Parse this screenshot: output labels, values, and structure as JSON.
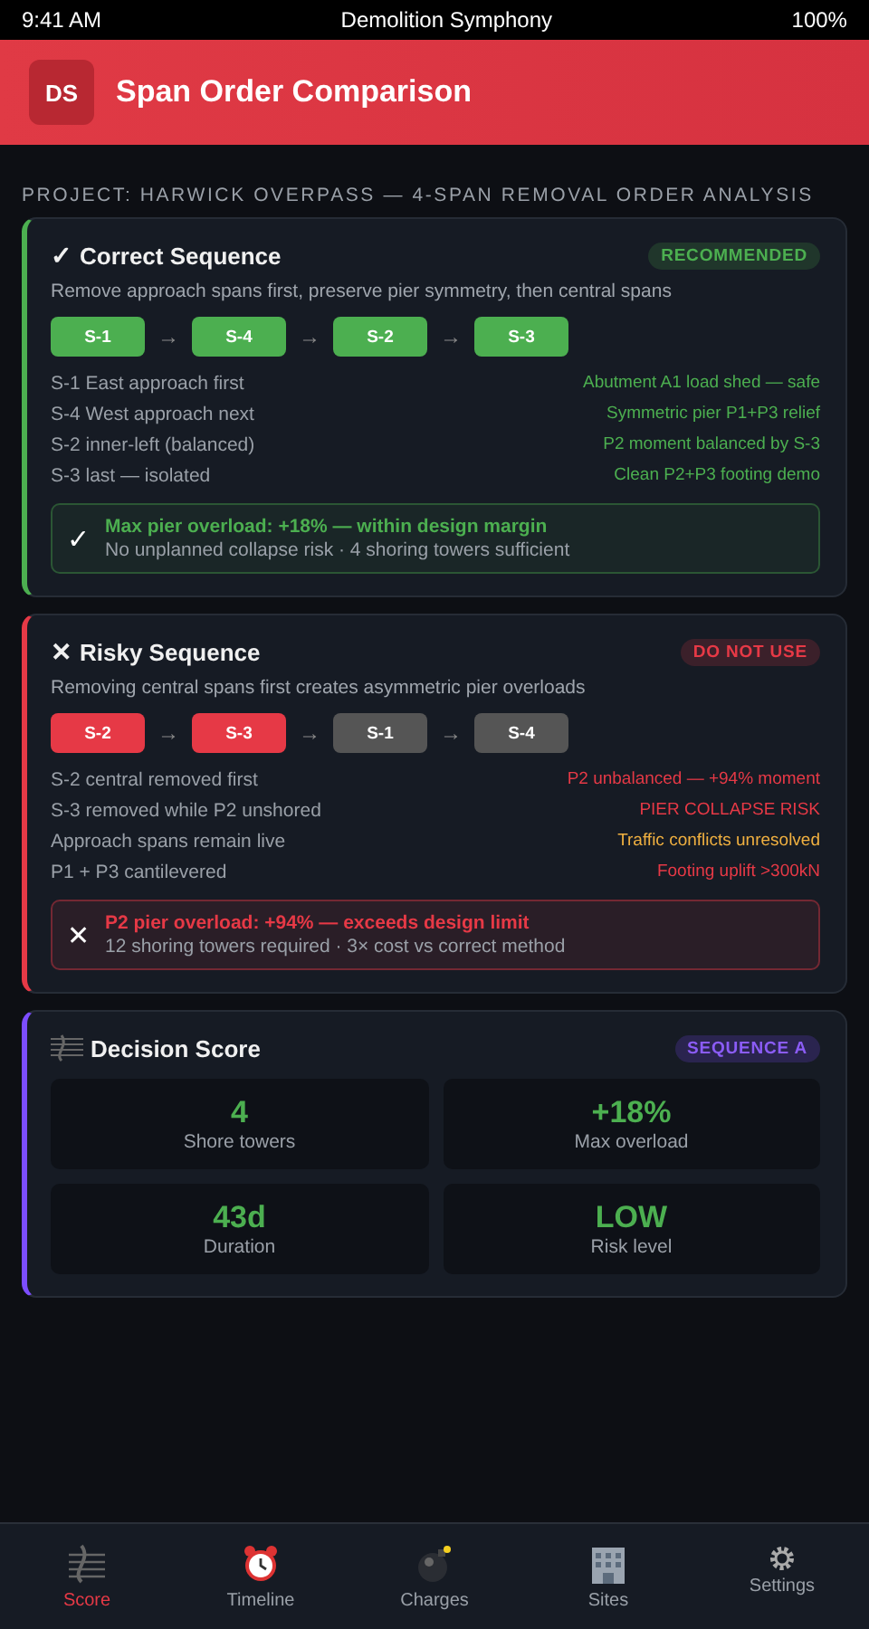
{
  "status_bar": {
    "time": "9:41 AM",
    "title": "Demolition Symphony",
    "battery": "100%"
  },
  "header": {
    "logo": "DS",
    "title": "Span Order Comparison"
  },
  "project_label": "PROJECT: HARWICK OVERPASS — 4-SPAN REMOVAL ORDER ANALYSIS",
  "sequences": [
    {
      "kind": "good",
      "mark": "✓",
      "title": "Correct Sequence",
      "badge": "RECOMMENDED",
      "description": "Remove approach spans first, preserve pier symmetry, then central spans",
      "steps": [
        {
          "label": "S-1",
          "color": "#4caf50"
        },
        {
          "label": "S-4",
          "color": "#4caf50"
        },
        {
          "label": "S-2",
          "color": "#4caf50"
        },
        {
          "label": "S-3",
          "color": "#4caf50"
        }
      ],
      "arrows": [
        "→",
        "→",
        "→"
      ],
      "rows": [
        {
          "label": "S-1 East approach first",
          "note": "Abutment A1 load shed — safe",
          "color": "#4caf50"
        },
        {
          "label": "S-4 West approach next",
          "note": "Symmetric pier P1+P3 relief",
          "color": "#4caf50"
        },
        {
          "label": "S-2 inner-left (balanced)",
          "note": "P2 moment balanced by S-3",
          "color": "#4caf50"
        },
        {
          "label": "S-3 last — isolated",
          "note": "Clean P2+P3 footing demo",
          "color": "#4caf50"
        }
      ],
      "summary": {
        "icon": "✓",
        "headline": "Max pier overload: +18% — within design margin",
        "detail": "No unplanned collapse risk · 4 shoring towers sufficient"
      }
    },
    {
      "kind": "bad",
      "mark": "✕",
      "title": "Risky Sequence",
      "badge": "DO NOT USE",
      "description": "Removing central spans first creates asymmetric pier overloads",
      "steps": [
        {
          "label": "S-2",
          "color": "#e63946"
        },
        {
          "label": "S-3",
          "color": "#e63946"
        },
        {
          "label": "S-1",
          "color": "#555555"
        },
        {
          "label": "S-4",
          "color": "#555555"
        }
      ],
      "arrows": [
        "→",
        "→",
        "→"
      ],
      "rows": [
        {
          "label": "S-2 central removed first",
          "note": "P2 unbalanced — +94% moment",
          "color": "#e63946"
        },
        {
          "label": "S-3 removed while P2 unshored",
          "note": "PIER COLLAPSE RISK",
          "color": "#e63946"
        },
        {
          "label": "Approach spans remain live",
          "note": "Traffic conflicts unresolved",
          "color": "#f0b040"
        },
        {
          "label": "P1 + P3 cantilevered",
          "note": "Footing uplift >300kN",
          "color": "#e63946"
        }
      ],
      "summary": {
        "icon": "✕",
        "headline": "P2 pier overload: +94% — exceeds design limit",
        "detail": "12 shoring towers required · 3× cost vs correct method"
      }
    }
  ],
  "decision": {
    "title": "Decision Score",
    "badge": "SEQUENCE A",
    "tiles": [
      {
        "value": "4",
        "label": "Shore towers"
      },
      {
        "value": "+18%",
        "label": "Max overload"
      },
      {
        "value": "43d",
        "label": "Duration"
      },
      {
        "value": "LOW",
        "label": "Risk level"
      }
    ]
  },
  "nav": [
    {
      "kind": "score",
      "label": "Score",
      "selected": true
    },
    {
      "kind": "clock",
      "label": "Timeline",
      "selected": false
    },
    {
      "kind": "bomb",
      "label": "Charges",
      "selected": false
    },
    {
      "kind": "building",
      "label": "Sites",
      "selected": false
    },
    {
      "kind": "gear",
      "label": "Settings",
      "selected": false
    }
  ]
}
